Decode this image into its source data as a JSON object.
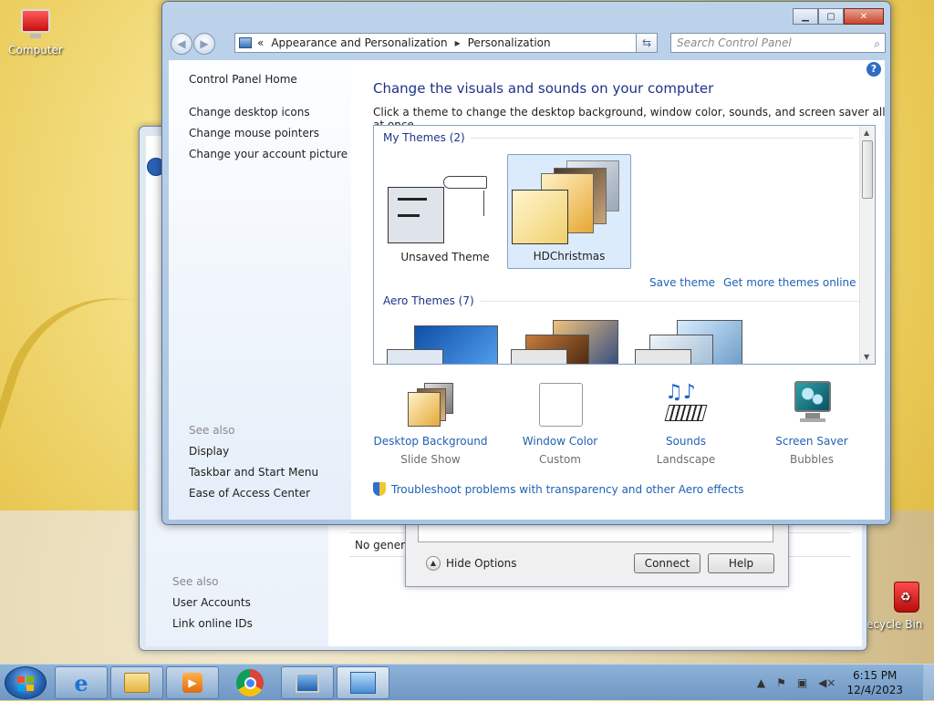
{
  "desktop": {
    "computer_label": "Computer",
    "recycle_label": "ecycle Bin"
  },
  "back_window": {
    "see_also_heading": "See also",
    "links": [
      "User Accounts",
      "Link online IDs"
    ],
    "row_text": "No generic"
  },
  "dialog": {
    "hide_options": "Hide Options",
    "connect": "Connect",
    "help": "Help"
  },
  "window": {
    "breadcrumb": [
      "Appearance and Personalization",
      "Personalization"
    ],
    "breadcrumb_prefix": "«",
    "search_placeholder": "Search Control Panel",
    "sidebar": {
      "home": "Control Panel Home",
      "tasks": [
        "Change desktop icons",
        "Change mouse pointers",
        "Change your account picture"
      ],
      "see_also_heading": "See also",
      "see_also": [
        "Display",
        "Taskbar and Start Menu",
        "Ease of Access Center"
      ]
    },
    "heading": "Change the visuals and sounds on your computer",
    "subheading": "Click a theme to change the desktop background, window color, sounds, and screen saver all at once.",
    "my_themes_label": "My Themes (2)",
    "themes": [
      {
        "name": "Unsaved Theme",
        "selected": false
      },
      {
        "name": "HDChristmas",
        "selected": true
      }
    ],
    "save_theme": "Save theme",
    "more_themes": "Get more themes online",
    "aero_label": "Aero Themes (7)",
    "options": [
      {
        "title": "Desktop Background",
        "value": "Slide Show",
        "icon": "desktop-background-icon"
      },
      {
        "title": "Window Color",
        "value": "Custom",
        "icon": "window-color-icon"
      },
      {
        "title": "Sounds",
        "value": "Landscape",
        "icon": "sounds-icon"
      },
      {
        "title": "Screen Saver",
        "value": "Bubbles",
        "icon": "screen-saver-icon"
      }
    ],
    "troubleshoot": "Troubleshoot problems with transparency and other Aero effects"
  },
  "taskbar": {
    "time": "6:15 PM",
    "date": "12/4/2023"
  },
  "colors": {
    "link": "#1f61b3",
    "heading": "#1e3287",
    "selection": "#dcebfc"
  }
}
